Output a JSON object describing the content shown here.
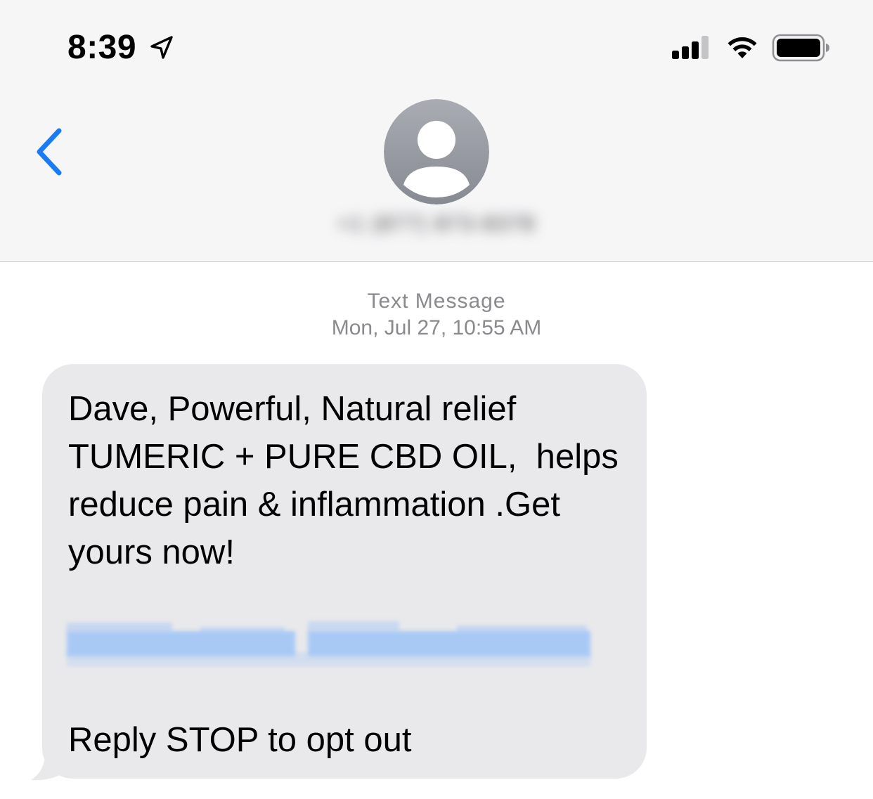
{
  "status_bar": {
    "time": "8:39",
    "icons": [
      "location-arrow-icon",
      "cellular-signal-icon",
      "wifi-icon",
      "battery-icon"
    ],
    "signal_bars": 3
  },
  "header": {
    "back_icon": "chevron-left-icon",
    "avatar_icon": "person-silhouette-icon",
    "contact_name": "+1 (877) 873-8378",
    "contact_name_redacted": true
  },
  "conversation": {
    "service_label": "Text Message",
    "timestamp": "Mon, Jul 27, 10:55 AM",
    "messages": [
      {
        "direction": "incoming",
        "body": "Dave, Powerful, Natural relief\nTUMERIC + PURE CBD OIL,  helps\nreduce pain & inflammation .Get\nyours now!",
        "link_redacted": true,
        "footer": "Reply STOP to opt out"
      }
    ]
  },
  "colors": {
    "header_bg": "#f6f6f7",
    "accent": "#1a7cf5",
    "bubble_bg": "#e9e9eb",
    "meta_text": "#8a8a8e",
    "avatar_bg": "#a1a4ab"
  }
}
